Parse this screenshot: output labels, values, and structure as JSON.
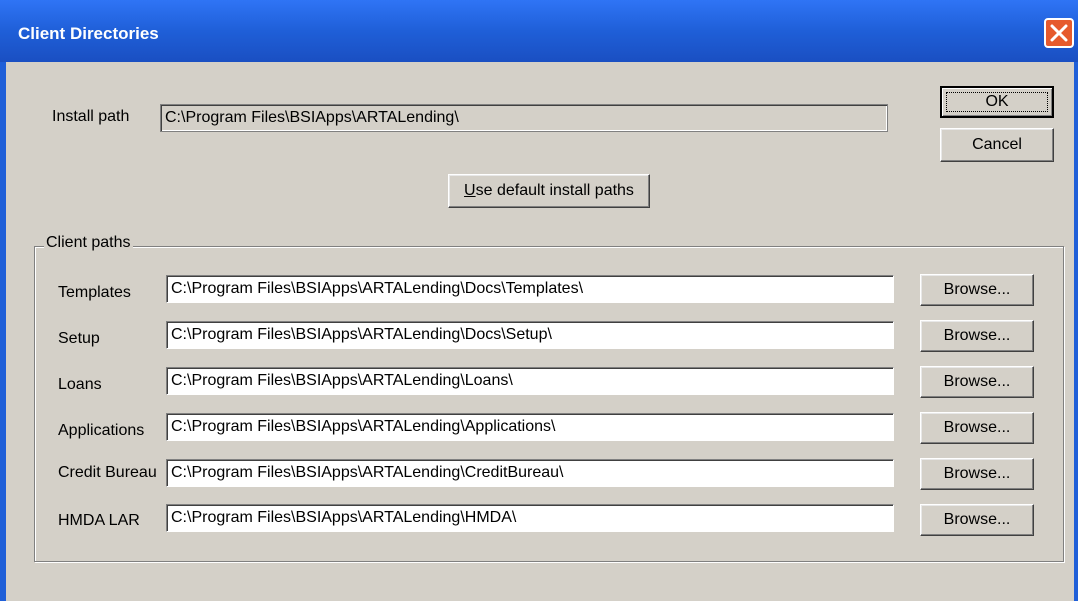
{
  "window": {
    "title": "Client Directories"
  },
  "install": {
    "label": "Install path",
    "value": "C:\\Program Files\\BSIApps\\ARTALending\\"
  },
  "buttons": {
    "ok": "OK",
    "cancel": "Cancel",
    "use_default_prefix": "U",
    "use_default_rest": "se default install paths",
    "browse": "Browse..."
  },
  "client_paths": {
    "group_title": "Client paths",
    "rows": [
      {
        "label": "Templates",
        "value": "C:\\Program Files\\BSIApps\\ARTALending\\Docs\\Templates\\"
      },
      {
        "label": "Setup",
        "value": "C:\\Program Files\\BSIApps\\ARTALending\\Docs\\Setup\\"
      },
      {
        "label": "Loans",
        "value": "C:\\Program Files\\BSIApps\\ARTALending\\Loans\\"
      },
      {
        "label": "Applications",
        "value": "C:\\Program Files\\BSIApps\\ARTALending\\Applications\\"
      },
      {
        "label": "Credit Bureau",
        "value": "C:\\Program Files\\BSIApps\\ARTALending\\CreditBureau\\"
      },
      {
        "label": "HMDA LAR",
        "value": "C:\\Program Files\\BSIApps\\ARTALending\\HMDA\\"
      }
    ]
  },
  "colors": {
    "titlebar": "#1f5fd8",
    "face": "#d4d0c8",
    "close": "#e65a2d"
  },
  "icons": {
    "close": "close-icon"
  }
}
